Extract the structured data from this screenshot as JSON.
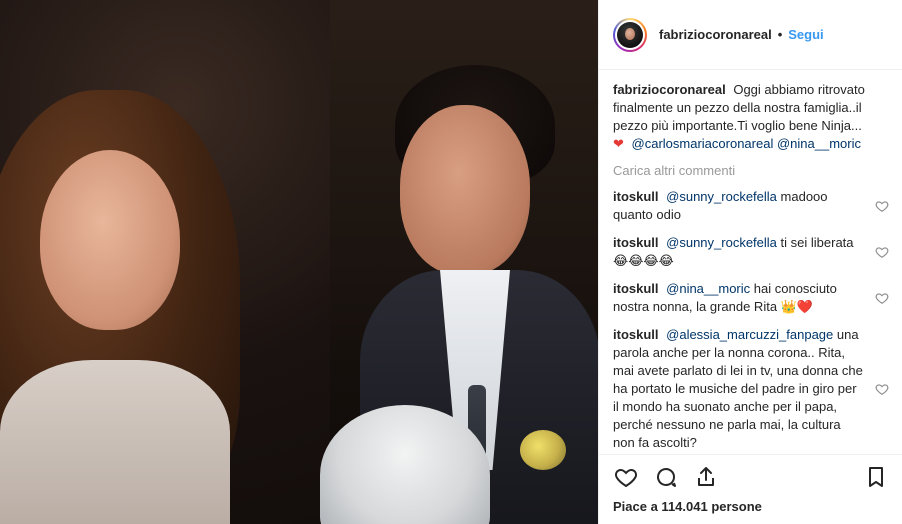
{
  "post": {
    "username": "fabriziocoronareal",
    "follow_label": "Segui",
    "separator": "•",
    "caption": {
      "text": "Oggi abbiamo ritrovato finalmente un pezzo della nostra famiglia..il pezzo più importante.Ti voglio bene Ninja...",
      "heart": "❤",
      "mentions": [
        "@carlosmariacoronareal",
        "@nina__moric"
      ]
    },
    "load_more_label": "Carica altri commenti",
    "comments": [
      {
        "user": "itoskull",
        "mention": "@sunny_rockefella",
        "text": "madooo quanto odio"
      },
      {
        "user": "itoskull",
        "mention": "@sunny_rockefella",
        "text": "ti sei liberata 😂😂😂😂"
      },
      {
        "user": "itoskull",
        "mention": "@nina__moric",
        "text": "hai conosciuto nostra nonna, la grande Rita 👑❤️"
      },
      {
        "user": "itoskull",
        "mention": "@alessia_marcuzzi_fanpage",
        "text": "una parola anche per la nonna corona.. Rita, mai avete parlato di lei in tv, una donna che ha portato le musiche del padre in giro per il mondo ha suonato anche per il papa, perché nessuno ne parla mai, la cultura non fa ascolti?"
      }
    ],
    "likes_label": "Piace a 114.041 persone"
  }
}
